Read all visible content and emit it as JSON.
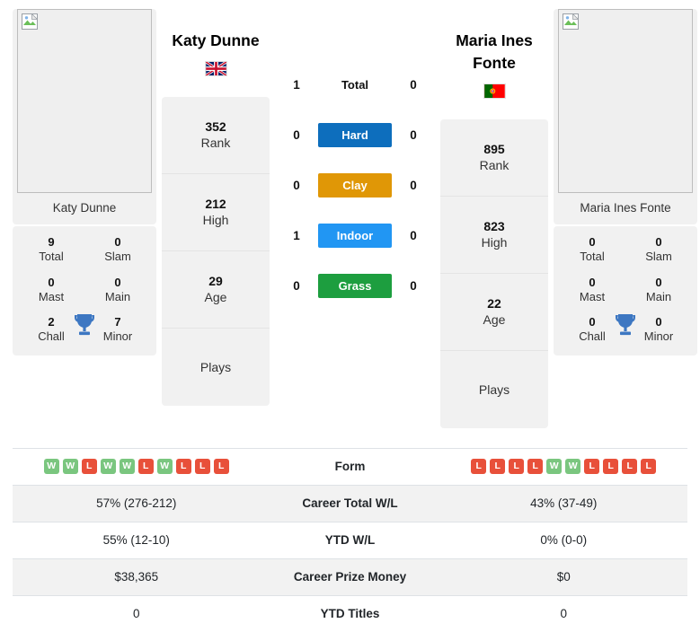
{
  "players": {
    "left": {
      "name": "Katy Dunne",
      "photo_caption": "Katy Dunne",
      "flag_name": "flag-gb",
      "flag_alt": "Great Britain",
      "rank": "352",
      "rank_label": "Rank",
      "high": "212",
      "high_label": "High",
      "age": "29",
      "age_label": "Age",
      "plays": "",
      "plays_label": "Plays",
      "trophies": [
        {
          "num": "9",
          "label": "Total"
        },
        {
          "num": "0",
          "label": "Slam"
        },
        {
          "num": "0",
          "label": "Mast"
        },
        {
          "num": "0",
          "label": "Main"
        },
        {
          "num": "2",
          "label": "Chall"
        },
        {
          "num": "7",
          "label": "Minor"
        }
      ],
      "form": [
        "W",
        "W",
        "L",
        "W",
        "W",
        "L",
        "W",
        "L",
        "L",
        "L"
      ],
      "career_wl": "57% (276-212)",
      "ytd_wl": "55% (12-10)",
      "career_prize_money": "$38,365",
      "ytd_titles": "0"
    },
    "right": {
      "name": "Maria Ines Fonte",
      "photo_caption": "Maria Ines Fonte",
      "flag_name": "flag-pt",
      "flag_alt": "Portugal",
      "rank": "895",
      "rank_label": "Rank",
      "high": "823",
      "high_label": "High",
      "age": "22",
      "age_label": "Age",
      "plays": "",
      "plays_label": "Plays",
      "trophies": [
        {
          "num": "0",
          "label": "Total"
        },
        {
          "num": "0",
          "label": "Slam"
        },
        {
          "num": "0",
          "label": "Mast"
        },
        {
          "num": "0",
          "label": "Main"
        },
        {
          "num": "0",
          "label": "Chall"
        },
        {
          "num": "0",
          "label": "Minor"
        }
      ],
      "form": [
        "L",
        "L",
        "L",
        "L",
        "W",
        "W",
        "L",
        "L",
        "L",
        "L"
      ],
      "career_wl": "43% (37-49)",
      "ytd_wl": "0% (0-0)",
      "career_prize_money": "$0",
      "ytd_titles": "0"
    }
  },
  "scoreboard": [
    {
      "label": "Total",
      "left": "1",
      "right": "0",
      "color": ""
    },
    {
      "label": "Hard",
      "left": "0",
      "right": "0",
      "color": "#0d6ebd"
    },
    {
      "label": "Clay",
      "left": "0",
      "right": "0",
      "color": "#e09706"
    },
    {
      "label": "Indoor",
      "left": "1",
      "right": "0",
      "color": "#2196f3"
    },
    {
      "label": "Grass",
      "left": "0",
      "right": "0",
      "color": "#1d9e3f"
    }
  ],
  "table": {
    "rows": [
      {
        "label": "Form",
        "type": "form"
      },
      {
        "label": "Career Total W/L",
        "type": "text",
        "key": "career_wl"
      },
      {
        "label": "YTD W/L",
        "type": "text",
        "key": "ytd_wl"
      },
      {
        "label": "Career Prize Money",
        "type": "text",
        "key": "career_prize_money"
      },
      {
        "label": "YTD Titles",
        "type": "text",
        "key": "ytd_titles"
      }
    ]
  },
  "colors": {
    "hard": "#0d6ebd",
    "clay": "#e09706",
    "indoor": "#2196f3",
    "grass": "#1d9e3f",
    "win": "#7ac67f",
    "loss": "#e8503a",
    "card_bg": "#f1f1f1",
    "stripe": "#f2f2f2"
  },
  "icons": {
    "trophy": "trophy-icon",
    "broken_image": "broken-image-icon"
  }
}
